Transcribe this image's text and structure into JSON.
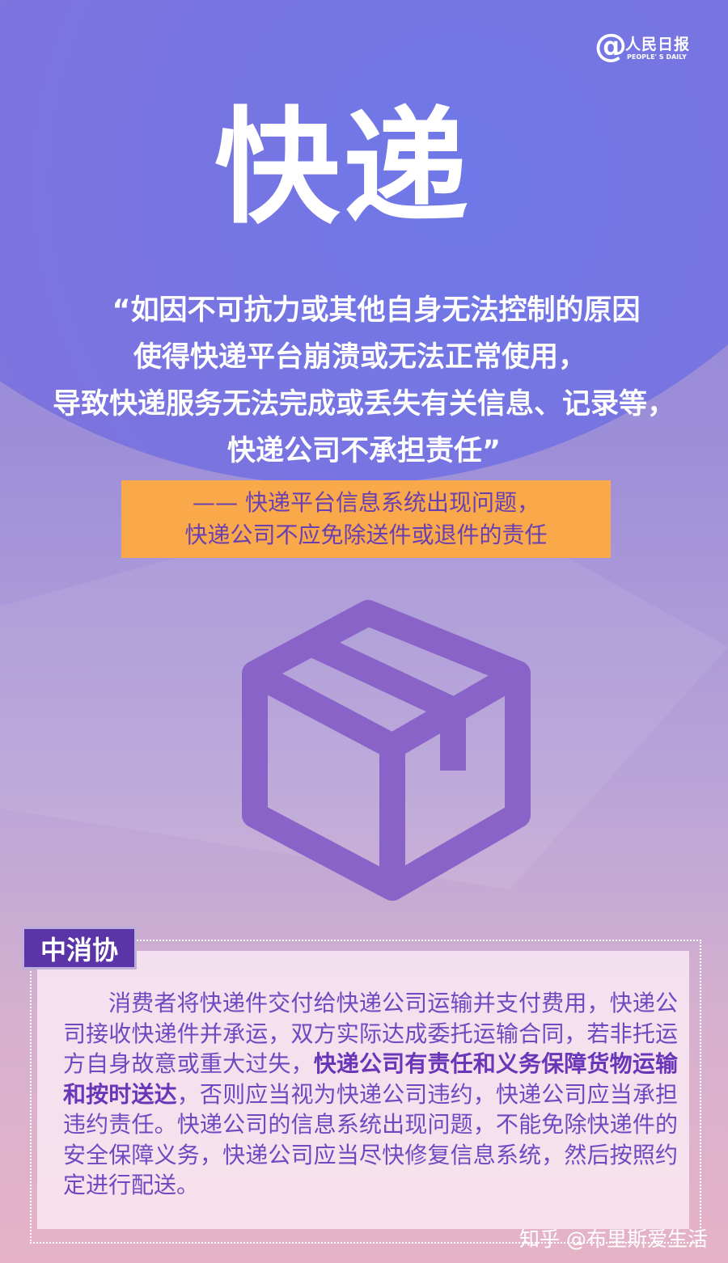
{
  "logo": {
    "symbol": "@",
    "name_cn": "人民日报",
    "name_en": "PEOPLE' S DAILY"
  },
  "title": "快递",
  "quote": {
    "lines": [
      "“如因不可抗力或其他自身无法控制的原因",
      "使得快递平台崩溃或无法正常使用，",
      "导致快递服务无法完成或丢失有关信息、记录等，",
      "快递公司不承担责任”"
    ]
  },
  "conclusion": {
    "lines": [
      "—— 快递平台信息系统出现问题，",
      "快递公司不应免除送件或退件的责任"
    ],
    "background": "#f9a84a"
  },
  "icon": "package-box-icon",
  "section": {
    "label": "中消协",
    "paragraph": {
      "before": "消费者将快递件交付给快递公司运输并支付费用，快递公司接收快递件并承运，双方实际达成委托运输合同，若非托运方自身故意或重大过失，",
      "bold": "快递公司有责任和义务保障货物运输和按时送达",
      "after": "，否则应当视为快递公司违约，快递公司应当承担违约责任。快递公司的信息系统出现问题，不能免除快递件的安全保障义务，快递公司应当尽快修复信息系统，然后按照约定进行配送。"
    }
  },
  "watermark": "知乎 @布里斯爱生活",
  "colors": {
    "accent_purple": "#5b35a8",
    "text_purple": "#7048c0",
    "orange": "#f9a84a"
  }
}
